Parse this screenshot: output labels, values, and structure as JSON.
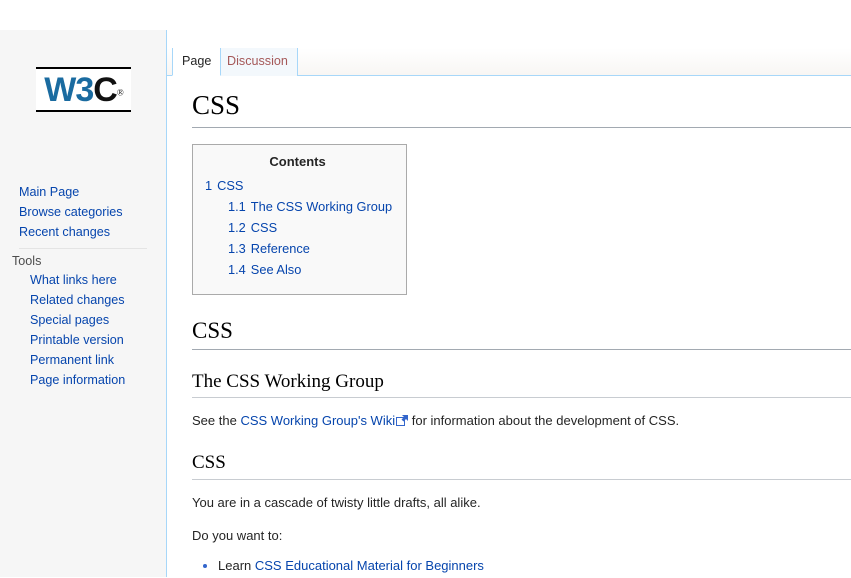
{
  "sidebar": {
    "logo": {
      "part_blue": "W3",
      "part_black": "C",
      "registered_mark": "®"
    },
    "main_nav": [
      {
        "label": "Main Page"
      },
      {
        "label": "Browse categories"
      },
      {
        "label": "Recent changes"
      }
    ],
    "tools_heading": "Tools",
    "tools_nav": [
      {
        "label": "What links here"
      },
      {
        "label": "Related changes"
      },
      {
        "label": "Special pages"
      },
      {
        "label": "Printable version"
      },
      {
        "label": "Permanent link"
      },
      {
        "label": "Page information"
      }
    ]
  },
  "tabs": [
    {
      "label": "Page",
      "state": "selected"
    },
    {
      "label": "Discussion",
      "state": "new"
    }
  ],
  "page": {
    "title": "CSS"
  },
  "toc": {
    "title": "Contents",
    "entries": [
      {
        "number": "1",
        "text": "CSS",
        "level": 1
      },
      {
        "number": "1.1",
        "text": "The CSS Working Group",
        "level": 2
      },
      {
        "number": "1.2",
        "text": "CSS",
        "level": 2
      },
      {
        "number": "1.3",
        "text": "Reference",
        "level": 2
      },
      {
        "number": "1.4",
        "text": "See Also",
        "level": 2
      }
    ]
  },
  "sections": {
    "h2_css": "CSS",
    "h3_working_group": "The CSS Working Group",
    "wg_para_before": "See the ",
    "wg_link": "CSS Working Group's Wiki",
    "wg_para_after": " for information about the development of CSS.",
    "h3_css": "CSS",
    "css_para_1": "You are in a cascade of twisty little drafts, all alike.",
    "css_para_2": "Do you want to:",
    "list_items": [
      {
        "prefix": "Learn ",
        "link": "CSS Educational Material for Beginners"
      }
    ]
  },
  "colors": {
    "link": "#0645ad",
    "new_link": "#a55858",
    "tab_border": "#a7d7f9",
    "sidebar_bg": "#f6f6f6",
    "toc_bg": "#f9f9f9",
    "toc_border": "#aaaaaa",
    "logo_blue": "#1a6ba0",
    "heading_rule": "#a2a9b1"
  }
}
